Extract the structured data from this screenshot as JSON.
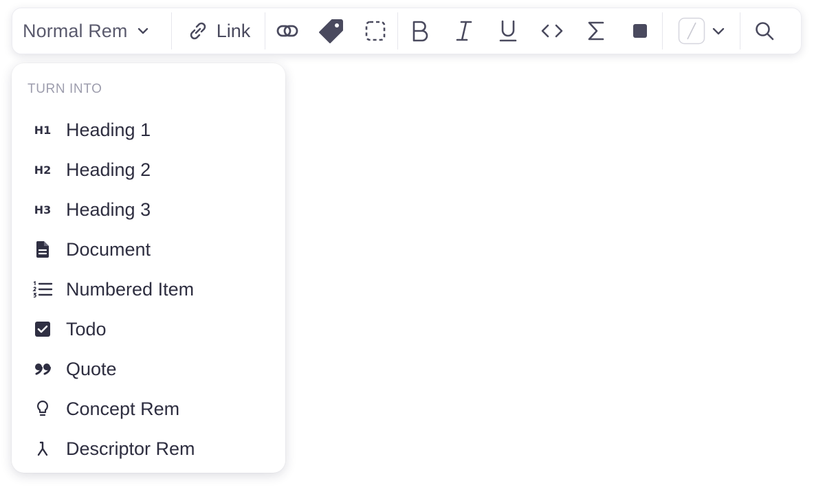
{
  "toolbar": {
    "block_type_label": "Normal Rem",
    "link_label": "Link",
    "icons": [
      "chevron-down-icon",
      "link-icon",
      "reference-icon",
      "tag-icon",
      "selection-box-icon",
      "bold-icon",
      "italic-icon",
      "underline-icon",
      "code-icon",
      "sigma-icon",
      "square-icon",
      "color-swatch-icon",
      "chevron-down-icon",
      "search-icon"
    ]
  },
  "menu": {
    "header": "TURN INTO",
    "items": [
      {
        "icon": "h1-icon",
        "glyph": "H1",
        "label": "Heading 1"
      },
      {
        "icon": "h2-icon",
        "glyph": "H2",
        "label": "Heading 2"
      },
      {
        "icon": "h3-icon",
        "glyph": "H3",
        "label": "Heading 3"
      },
      {
        "icon": "document-icon",
        "glyph": "",
        "label": "Document"
      },
      {
        "icon": "numbered-list-icon",
        "glyph": "",
        "label": "Numbered Item"
      },
      {
        "icon": "checkbox-icon",
        "glyph": "",
        "label": "Todo"
      },
      {
        "icon": "quote-icon",
        "glyph": "",
        "label": "Quote"
      },
      {
        "icon": "lightbulb-icon",
        "glyph": "",
        "label": "Concept Rem"
      },
      {
        "icon": "descriptor-icon",
        "glyph": "",
        "label": "Descriptor Rem"
      }
    ]
  },
  "colors": {
    "icon": "#4a4a5e",
    "text": "#2e2e40",
    "muted": "#9d9dad",
    "divider": "#e6e6ec"
  }
}
